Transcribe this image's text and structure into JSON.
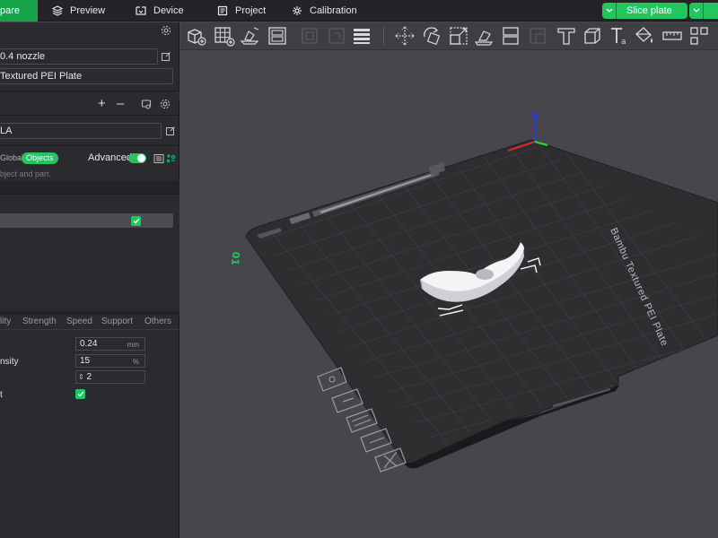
{
  "nav": {
    "tabs": [
      {
        "label": "pare",
        "icon": "prepare-icon",
        "active": true
      },
      {
        "label": "Preview",
        "icon": "layers-icon"
      },
      {
        "label": "Device",
        "icon": "device-icon"
      },
      {
        "label": "Project",
        "icon": "project-icon"
      },
      {
        "label": "Calibration",
        "icon": "calibration-icon"
      }
    ],
    "slice_label": "Slice plate"
  },
  "printer": {
    "nozzle": "0.4 nozzle",
    "plate": "Textured PEI Plate"
  },
  "filament": {
    "value": "LA"
  },
  "process": {
    "global_label": "Global",
    "objects_label": "Objects",
    "advanced_label": "Advanced",
    "hint": "bject and part."
  },
  "settings_tabs": [
    "lity",
    "Strength",
    "Speed",
    "Support",
    "Others"
  ],
  "params": [
    {
      "label": "",
      "value": "0.24",
      "unit": "mm"
    },
    {
      "label": "nsity",
      "value": "15",
      "unit": "%"
    },
    {
      "label": "",
      "value": "2",
      "unit": ""
    },
    {
      "label": "t",
      "checked": true
    }
  ],
  "plate_text": "Bambu Textured PEI Plate",
  "plate_number": "01",
  "colors": {
    "accent": "#22c55e",
    "topbar": "#242428",
    "sidebar": "#2b2b2f",
    "viewport": "#46464b"
  }
}
